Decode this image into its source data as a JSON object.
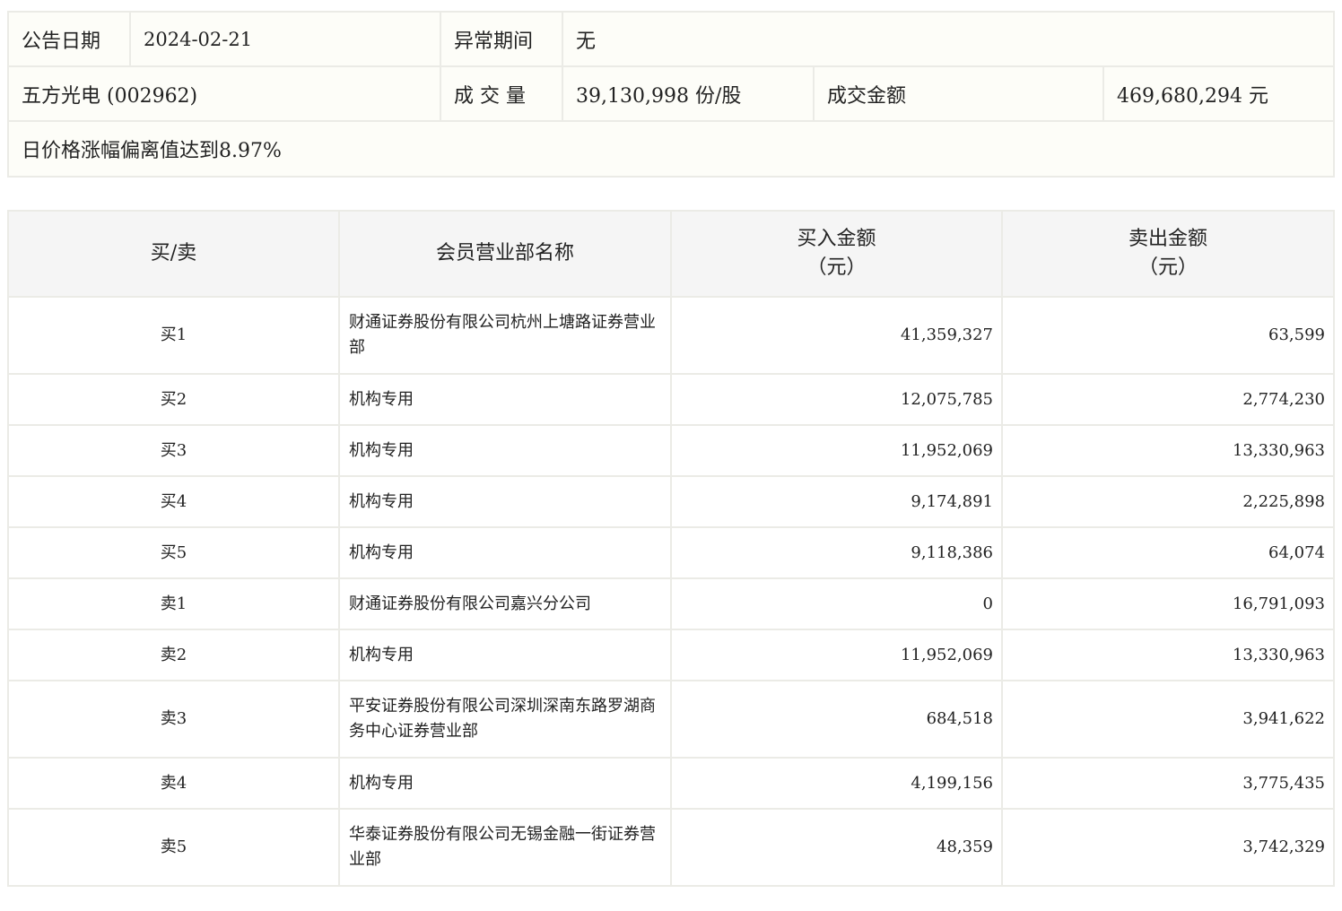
{
  "info": {
    "date_label": "公告日期",
    "date_value": "2024-02-21",
    "period_label": "异常期间",
    "period_value": "无",
    "stock_name": "五方光电 (002962)",
    "volume_label": "成 交 量",
    "volume_value": "39,130,998 份/股",
    "amount_label": "成交金额",
    "amount_value": "469,680,294 元",
    "reason": "日价格涨幅偏离值达到8.97%"
  },
  "detail": {
    "headers": {
      "side": "买/卖",
      "dept": "会员营业部名称",
      "buy_line1": "买入金额",
      "buy_line2": "（元）",
      "sell_line1": "卖出金额",
      "sell_line2": "（元）"
    },
    "rows": [
      {
        "side": "买1",
        "dept": "财通证券股份有限公司杭州上塘路证券营业部",
        "buy": "41,359,327",
        "sell": "63,599"
      },
      {
        "side": "买2",
        "dept": "机构专用",
        "buy": "12,075,785",
        "sell": "2,774,230"
      },
      {
        "side": "买3",
        "dept": "机构专用",
        "buy": "11,952,069",
        "sell": "13,330,963"
      },
      {
        "side": "买4",
        "dept": "机构专用",
        "buy": "9,174,891",
        "sell": "2,225,898"
      },
      {
        "side": "买5",
        "dept": "机构专用",
        "buy": "9,118,386",
        "sell": "64,074"
      },
      {
        "side": "卖1",
        "dept": "财通证券股份有限公司嘉兴分公司",
        "buy": "0",
        "sell": "16,791,093"
      },
      {
        "side": "卖2",
        "dept": "机构专用",
        "buy": "11,952,069",
        "sell": "13,330,963"
      },
      {
        "side": "卖3",
        "dept": "平安证券股份有限公司深圳深南东路罗湖商务中心证券营业部",
        "buy": "684,518",
        "sell": "3,941,622"
      },
      {
        "side": "卖4",
        "dept": "机构专用",
        "buy": "4,199,156",
        "sell": "3,775,435"
      },
      {
        "side": "卖5",
        "dept": "华泰证券股份有限公司无锡金融一街证券营业部",
        "buy": "48,359",
        "sell": "3,742,329"
      }
    ]
  }
}
